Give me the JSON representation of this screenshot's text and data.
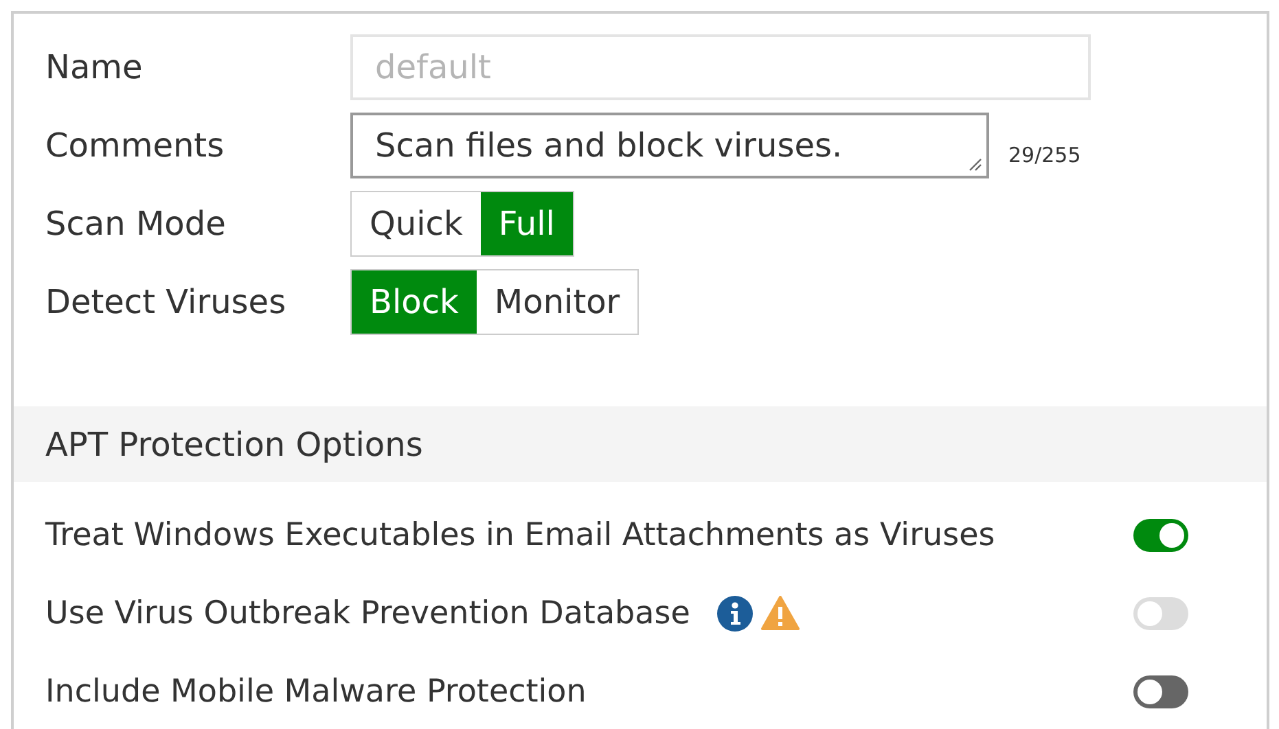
{
  "form": {
    "fields": [
      {
        "kind": "text",
        "label": "Name",
        "value": "default",
        "disabled": true
      },
      {
        "kind": "textarea",
        "label": "Comments",
        "value": "Scan files and block viruses.",
        "counter": "29/255"
      },
      {
        "kind": "segmented",
        "label": "Scan Mode",
        "options": [
          {
            "label": "Quick",
            "selected": false
          },
          {
            "label": "Full",
            "selected": true
          }
        ]
      },
      {
        "kind": "segmented",
        "label": "Detect Viruses",
        "options": [
          {
            "label": "Block",
            "selected": true
          },
          {
            "label": "Monitor",
            "selected": false
          }
        ]
      }
    ]
  },
  "section": {
    "title": "APT Protection Options",
    "options": [
      {
        "label": "Treat Windows Executables in Email Attachments as Viruses",
        "on": true,
        "disabled": false,
        "info": false,
        "warning": false
      },
      {
        "label": "Use Virus Outbreak Prevention Database",
        "on": false,
        "disabled": true,
        "info": true,
        "warning": true
      },
      {
        "label": "Include Mobile Malware Protection",
        "on": false,
        "disabled": false,
        "info": false,
        "warning": false
      }
    ]
  }
}
